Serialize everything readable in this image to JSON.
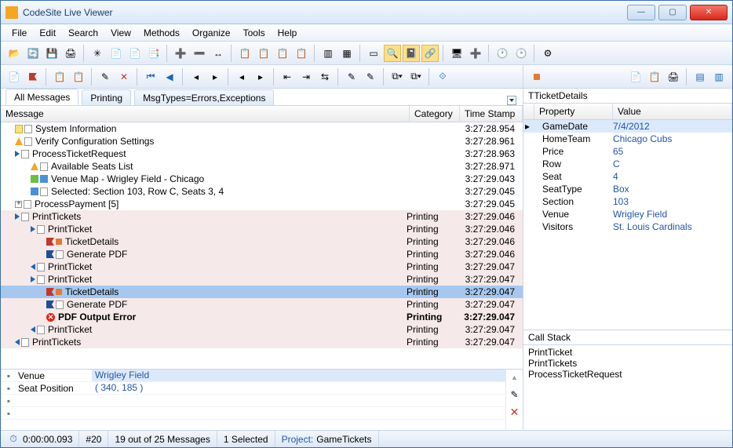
{
  "window": {
    "title": "CodeSite Live Viewer"
  },
  "menu": [
    "File",
    "Edit",
    "Search",
    "View",
    "Methods",
    "Organize",
    "Tools",
    "Help"
  ],
  "tabs": [
    {
      "label": "All Messages",
      "active": true
    },
    {
      "label": "Printing",
      "active": false
    },
    {
      "label": "MsgTypes=Errors,Exceptions",
      "active": false
    }
  ],
  "columns": {
    "message": "Message",
    "category": "Category",
    "timestamp": "Time Stamp"
  },
  "messages": [
    {
      "indent": 0,
      "icons": [
        "doc",
        "page"
      ],
      "text": "System Information",
      "cat": "",
      "ts": "3:27:28.954"
    },
    {
      "indent": 0,
      "icons": [
        "warn",
        "page"
      ],
      "text": "Verify Configuration Settings",
      "cat": "",
      "ts": "3:27:28.961"
    },
    {
      "indent": 0,
      "icons": [
        "arr-r",
        "page"
      ],
      "text": "ProcessTicketRequest",
      "cat": "",
      "ts": "3:27:28.963",
      "bold": false,
      "enter": true
    },
    {
      "indent": 1,
      "icons": [
        "warn",
        "page"
      ],
      "text": "Available Seats List",
      "cat": "",
      "ts": "3:27:28.971"
    },
    {
      "indent": 1,
      "icons": [
        "boxg",
        "box"
      ],
      "text": "Venue Map - Wrigley Field - Chicago",
      "cat": "",
      "ts": "3:27:29.043"
    },
    {
      "indent": 1,
      "icons": [
        "box",
        "page"
      ],
      "text": "Selected: Section 103, Row C, Seats 3, 4",
      "cat": "",
      "ts": "3:27:29.045"
    },
    {
      "indent": 0,
      "icons": [
        "plus",
        "page"
      ],
      "text": "ProcessPayment  [5]",
      "cat": "",
      "ts": "3:27:29.045"
    },
    {
      "indent": 0,
      "icons": [
        "arr-r",
        "page"
      ],
      "text": "PrintTickets",
      "cat": "Printing",
      "ts": "3:27:29.046",
      "pink": true,
      "enter": true
    },
    {
      "indent": 1,
      "icons": [
        "arr-r",
        "page"
      ],
      "text": "PrintTicket",
      "cat": "Printing",
      "ts": "3:27:29.046",
      "pink": true,
      "enter": true
    },
    {
      "indent": 2,
      "icons": [
        "flag",
        "cp"
      ],
      "text": "TicketDetails",
      "cat": "Printing",
      "ts": "3:27:29.046",
      "pink": true
    },
    {
      "indent": 2,
      "icons": [
        "flagb",
        "page"
      ],
      "text": "Generate PDF",
      "cat": "Printing",
      "ts": "3:27:29.046",
      "pink": true
    },
    {
      "indent": 1,
      "icons": [
        "arr-l",
        "page"
      ],
      "text": "PrintTicket",
      "cat": "Printing",
      "ts": "3:27:29.047",
      "pink": true,
      "exit": true
    },
    {
      "indent": 1,
      "icons": [
        "arr-r",
        "page"
      ],
      "text": "PrintTicket",
      "cat": "Printing",
      "ts": "3:27:29.047",
      "pink": true,
      "enter": true
    },
    {
      "indent": 2,
      "icons": [
        "flag",
        "cp"
      ],
      "text": "TicketDetails",
      "cat": "Printing",
      "ts": "3:27:29.047",
      "sel": true
    },
    {
      "indent": 2,
      "icons": [
        "flagb",
        "page"
      ],
      "text": "Generate PDF",
      "cat": "Printing",
      "ts": "3:27:29.047",
      "pink": true
    },
    {
      "indent": 2,
      "icons": [
        "err"
      ],
      "text": "PDF Output Error",
      "cat": "Printing",
      "ts": "3:27:29.047",
      "pink": true,
      "bold": true
    },
    {
      "indent": 1,
      "icons": [
        "arr-l",
        "page"
      ],
      "text": "PrintTicket",
      "cat": "Printing",
      "ts": "3:27:29.047",
      "pink": true,
      "exit": true
    },
    {
      "indent": 0,
      "icons": [
        "arr-l",
        "page"
      ],
      "text": "PrintTickets",
      "cat": "Printing",
      "ts": "3:27:29.047",
      "pink": true,
      "exit": true
    }
  ],
  "bottom": {
    "rows": [
      {
        "key": "Venue",
        "value": "Wrigley Field",
        "hl": true
      },
      {
        "key": "Seat Position",
        "value": "( 340, 185 )",
        "hl": false
      }
    ],
    "empty_rows": 2
  },
  "details": {
    "title": "TTicketDetails",
    "header": {
      "prop": "Property",
      "val": "Value"
    },
    "rows": [
      {
        "k": "GameDate",
        "v": "7/4/2012",
        "sel": true
      },
      {
        "k": "HomeTeam",
        "v": "Chicago Cubs"
      },
      {
        "k": "Price",
        "v": "65"
      },
      {
        "k": "Row",
        "v": "C"
      },
      {
        "k": "Seat",
        "v": "4"
      },
      {
        "k": "SeatType",
        "v": "Box"
      },
      {
        "k": "Section",
        "v": "103"
      },
      {
        "k": "Venue",
        "v": "Wrigley Field"
      },
      {
        "k": "Visitors",
        "v": "St. Louis Cardinals"
      }
    ]
  },
  "callstack": {
    "title": "Call Stack",
    "items": [
      "PrintTicket",
      "PrintTickets",
      "ProcessTicketRequest"
    ]
  },
  "statusbar": {
    "elapsed": "0:00:00.093",
    "count": "#20",
    "filtered": "19 out of 25 Messages",
    "selected": "1 Selected",
    "project_label": "Project:",
    "project_value": "GameTickets"
  }
}
